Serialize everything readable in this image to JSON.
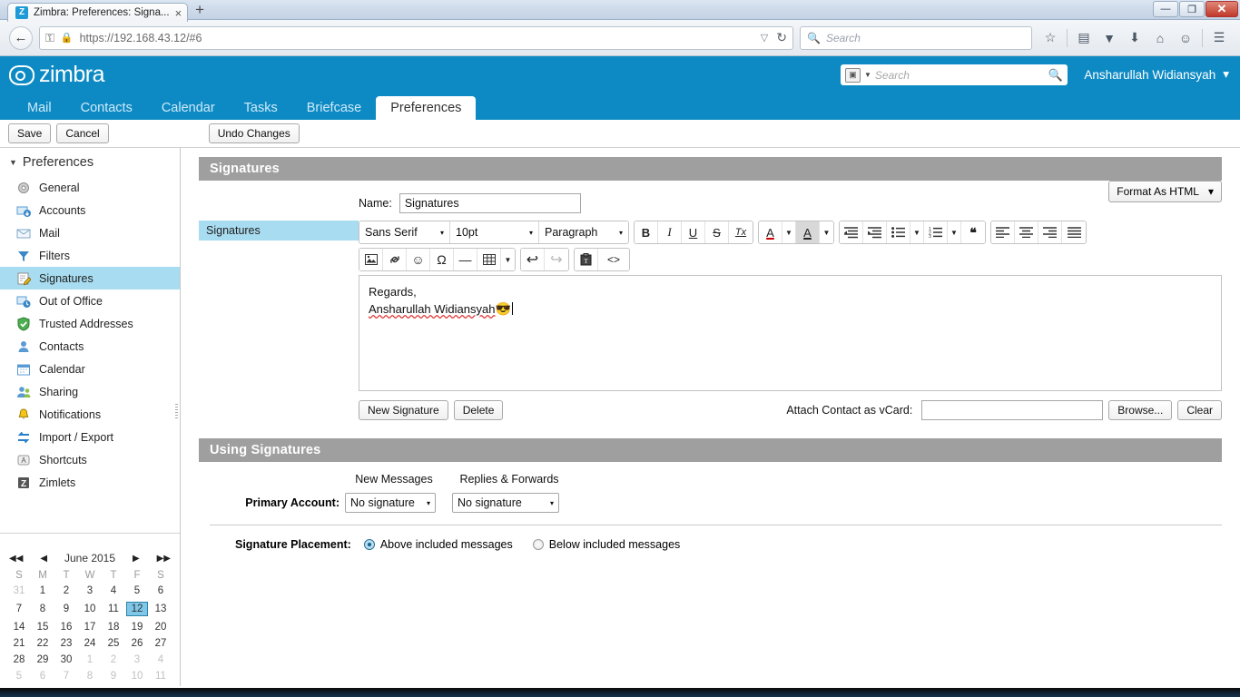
{
  "browser": {
    "tab_title": "Zimbra: Preferences: Signa...",
    "tab_favicon_letter": "Z",
    "close_tab_glyph": "×",
    "new_tab_glyph": "+",
    "window_minimize": "—",
    "window_restore": "❐",
    "window_close": "✕",
    "back_glyph": "←",
    "url": "https://192.168.43.12/#6",
    "lock_glyph": "🔒",
    "key_glyph": "⚿",
    "dropdown_glyph": "▽",
    "reload_glyph": "↻",
    "search_placeholder": "Search",
    "search_icon": "🔍",
    "toolbar_icons": [
      {
        "name": "bookmark-star-icon",
        "glyph": "☆"
      },
      {
        "name": "reader-view-icon",
        "glyph": "▤"
      },
      {
        "name": "pocket-icon",
        "glyph": "▼"
      },
      {
        "name": "downloads-icon",
        "glyph": "⬇"
      },
      {
        "name": "home-icon",
        "glyph": "⌂"
      },
      {
        "name": "sync-smiley-icon",
        "glyph": "☺"
      },
      {
        "name": "hamburger-menu-icon",
        "glyph": "☰"
      }
    ]
  },
  "zimbra": {
    "logo_text": "zimbra",
    "search_placeholder": "Search",
    "search_go_icon": "🔍",
    "user_name": "Ansharullah Widiansyah",
    "user_caret": "▾",
    "refresh_icon": "↻",
    "tabs": [
      {
        "label": "Mail",
        "active": false
      },
      {
        "label": "Contacts",
        "active": false
      },
      {
        "label": "Calendar",
        "active": false
      },
      {
        "label": "Tasks",
        "active": false
      },
      {
        "label": "Briefcase",
        "active": false
      },
      {
        "label": "Preferences",
        "active": true
      }
    ]
  },
  "toolbar": {
    "save_label": "Save",
    "cancel_label": "Cancel",
    "undo_label": "Undo Changes"
  },
  "sidebar": {
    "header": "Preferences",
    "header_caret": "▼",
    "items": [
      {
        "label": "General",
        "icon": "gear-icon",
        "active": false
      },
      {
        "label": "Accounts",
        "icon": "accounts-icon",
        "active": false
      },
      {
        "label": "Mail",
        "icon": "envelope-icon",
        "active": false
      },
      {
        "label": "Filters",
        "icon": "filter-icon",
        "active": false
      },
      {
        "label": "Signatures",
        "icon": "signature-icon",
        "active": true
      },
      {
        "label": "Out of Office",
        "icon": "out-of-office-icon",
        "active": false
      },
      {
        "label": "Trusted Addresses",
        "icon": "shield-icon",
        "active": false
      },
      {
        "label": "Contacts",
        "icon": "contact-icon",
        "active": false
      },
      {
        "label": "Calendar",
        "icon": "calendar-icon",
        "active": false
      },
      {
        "label": "Sharing",
        "icon": "sharing-icon",
        "active": false
      },
      {
        "label": "Notifications",
        "icon": "bell-icon",
        "active": false
      },
      {
        "label": "Import / Export",
        "icon": "import-export-icon",
        "active": false
      },
      {
        "label": "Shortcuts",
        "icon": "shortcuts-icon",
        "active": false
      },
      {
        "label": "Zimlets",
        "icon": "zimlets-icon",
        "active": false
      }
    ]
  },
  "minicalendar": {
    "title": "June 2015",
    "prev_year": "◀◀",
    "prev_month": "◀",
    "next_month": "▶",
    "next_year": "▶▶",
    "weekdays": [
      "S",
      "M",
      "T",
      "W",
      "T",
      "F",
      "S"
    ],
    "today": 12,
    "weeks": [
      [
        {
          "d": 31,
          "out": true
        },
        {
          "d": 1
        },
        {
          "d": 2
        },
        {
          "d": 3
        },
        {
          "d": 4
        },
        {
          "d": 5
        },
        {
          "d": 6
        }
      ],
      [
        {
          "d": 7
        },
        {
          "d": 8
        },
        {
          "d": 9
        },
        {
          "d": 10
        },
        {
          "d": 11
        },
        {
          "d": 12,
          "today": true
        },
        {
          "d": 13
        }
      ],
      [
        {
          "d": 14
        },
        {
          "d": 15
        },
        {
          "d": 16
        },
        {
          "d": 17
        },
        {
          "d": 18
        },
        {
          "d": 19
        },
        {
          "d": 20
        }
      ],
      [
        {
          "d": 21
        },
        {
          "d": 22
        },
        {
          "d": 23
        },
        {
          "d": 24
        },
        {
          "d": 25
        },
        {
          "d": 26
        },
        {
          "d": 27
        }
      ],
      [
        {
          "d": 28
        },
        {
          "d": 29
        },
        {
          "d": 30
        },
        {
          "d": 1,
          "out": true
        },
        {
          "d": 2,
          "out": true
        },
        {
          "d": 3,
          "out": true
        },
        {
          "d": 4,
          "out": true
        }
      ],
      [
        {
          "d": 5,
          "out": true
        },
        {
          "d": 6,
          "out": true
        },
        {
          "d": 7,
          "out": true
        },
        {
          "d": 8,
          "out": true
        },
        {
          "d": 9,
          "out": true
        },
        {
          "d": 10,
          "out": true
        },
        {
          "d": 11,
          "out": true
        }
      ]
    ]
  },
  "signatures_section": {
    "title": "Signatures",
    "name_label": "Name:",
    "name_value": "Signatures",
    "format_select": "Format As HTML",
    "format_caret": "▾",
    "list": [
      {
        "label": "Signatures",
        "selected": true
      }
    ],
    "editor_toolbar": {
      "font_family": "Sans Serif",
      "font_size": "10pt",
      "paragraph_style": "Paragraph",
      "caret": "▾",
      "buttons_row1": [
        {
          "name": "bold-button",
          "glyph": "B"
        },
        {
          "name": "italic-button",
          "glyph": "I"
        },
        {
          "name": "underline-button",
          "glyph": "U"
        },
        {
          "name": "strikethrough-button",
          "glyph": "S"
        },
        {
          "name": "remove-format-button",
          "glyph": "Tx"
        }
      ],
      "color_buttons": [
        {
          "name": "font-color-button",
          "glyph": "A"
        },
        {
          "name": "highlight-color-button",
          "glyph": "A"
        }
      ],
      "indent_buttons": [
        {
          "name": "outdent-button",
          "glyph": "≡◂"
        },
        {
          "name": "indent-button",
          "glyph": "≡▸"
        }
      ],
      "list_buttons": [
        {
          "name": "bulleted-list-button",
          "glyph": "☰"
        },
        {
          "name": "numbered-list-button",
          "glyph": "☰"
        }
      ],
      "quote_button": {
        "name": "block-quote-button",
        "glyph": "❝"
      },
      "align_buttons": [
        {
          "name": "align-left-button",
          "glyph": "≡"
        },
        {
          "name": "align-center-button",
          "glyph": "≡"
        },
        {
          "name": "align-right-button",
          "glyph": "≡"
        },
        {
          "name": "align-justify-button",
          "glyph": "≡"
        }
      ],
      "buttons_row2": [
        {
          "name": "insert-image-button",
          "glyph": "🖼"
        },
        {
          "name": "insert-link-button",
          "glyph": "🔗"
        },
        {
          "name": "insert-emoticon-button",
          "glyph": "☺"
        },
        {
          "name": "insert-symbol-button",
          "glyph": "Ω"
        },
        {
          "name": "horizontal-rule-button",
          "glyph": "—"
        },
        {
          "name": "insert-table-button",
          "glyph": "▦"
        },
        {
          "name": "undo-button",
          "glyph": "↩"
        },
        {
          "name": "redo-button",
          "glyph": "↪"
        },
        {
          "name": "paste-as-text-button",
          "glyph": "📋"
        },
        {
          "name": "source-code-button",
          "glyph": "<>"
        }
      ]
    },
    "content": {
      "line1": "Regards,",
      "line2": "Ansharullah Widiansyah",
      "emoji": "😎"
    },
    "new_signature_label": "New Signature",
    "delete_label": "Delete",
    "vcard_label": "Attach Contact as vCard:",
    "vcard_value": "",
    "browse_label": "Browse...",
    "clear_label": "Clear"
  },
  "using_signatures": {
    "title": "Using Signatures",
    "col_new_messages": "New Messages",
    "col_replies_forwards": "Replies & Forwards",
    "primary_account_label": "Primary Account:",
    "new_messages_value": "No signature",
    "replies_value": "No signature",
    "caret": "▾",
    "placement_label": "Signature Placement:",
    "placement_above": "Above included messages",
    "placement_below": "Below included messages",
    "placement_selected": "above"
  },
  "colors": {
    "zimbra_blue": "#0d8ac4",
    "section_gray": "#9f9f9f",
    "selection_blue": "#a8dcf0"
  }
}
